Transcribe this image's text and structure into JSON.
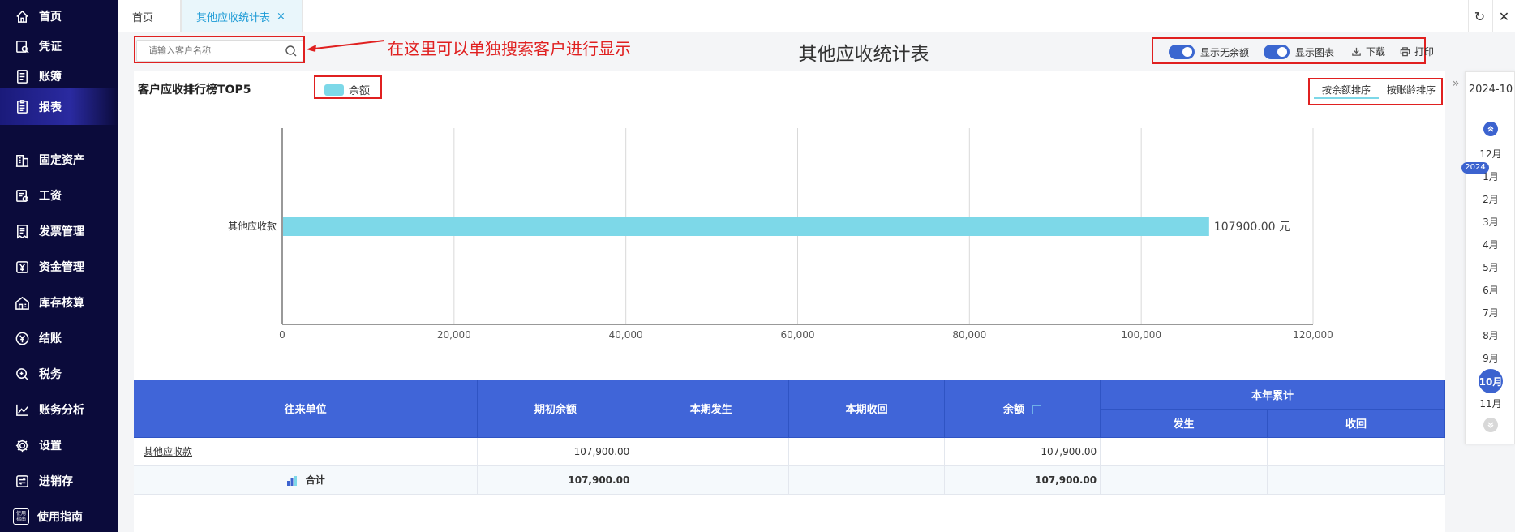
{
  "sidebar": {
    "items": [
      {
        "label": "首页",
        "icon": "home-icon"
      },
      {
        "label": "凭证",
        "icon": "voucher-icon"
      },
      {
        "label": "账簿",
        "icon": "ledger-icon"
      },
      {
        "label": "报表",
        "icon": "report-icon",
        "active": true
      },
      {
        "label": "固定资产",
        "icon": "building-icon"
      },
      {
        "label": "工资",
        "icon": "salary-icon"
      },
      {
        "label": "发票管理",
        "icon": "invoice-icon"
      },
      {
        "label": "资金管理",
        "icon": "yen-icon"
      },
      {
        "label": "库存核算",
        "icon": "warehouse-icon"
      },
      {
        "label": "结账",
        "icon": "settle-icon"
      },
      {
        "label": "税务",
        "icon": "tax-icon"
      },
      {
        "label": "账务分析",
        "icon": "analysis-icon"
      },
      {
        "label": "设置",
        "icon": "gear-icon"
      },
      {
        "label": "进销存",
        "icon": "inventory-icon"
      },
      {
        "label": "使用指南",
        "icon": "guide-icon"
      }
    ],
    "guide_icon_text": "使用指南"
  },
  "tabs": {
    "home": "首页",
    "active": "其他应收统计表",
    "close": "×",
    "refresh": "↻",
    "close_window": "✕"
  },
  "toolbar": {
    "search_placeholder": "请输入客户名称",
    "annotation": "在这里可以单独搜索客户进行显示",
    "page_title": "其他应收统计表",
    "toggle_zero_balance": "显示无余额",
    "toggle_chart": "显示图表",
    "download": "下载",
    "print": "打印"
  },
  "chart_section": {
    "title": "客户应收排行榜TOP5",
    "legend": "余额",
    "sort_by_amount": "按余额排序",
    "sort_by_aging": "按账龄排序"
  },
  "chart_data": {
    "type": "bar",
    "orientation": "horizontal",
    "categories": [
      "其他应收款"
    ],
    "series": [
      {
        "name": "余额",
        "values": [
          107900.0
        ]
      }
    ],
    "value_label_suffix": " 元",
    "value_labels": [
      "107900.00 元"
    ],
    "xlim": [
      0,
      120000
    ],
    "xticks": [
      0,
      20000,
      40000,
      60000,
      80000,
      100000,
      120000
    ],
    "xtick_labels": [
      "0",
      "20,000",
      "40,000",
      "60,000",
      "80,000",
      "100,000",
      "120,000"
    ],
    "grid": true,
    "legend_position": "top-left",
    "bar_color": "#7dd8e8"
  },
  "table": {
    "headers": {
      "unit": "往来单位",
      "opening": "期初余额",
      "period_occur": "本期发生",
      "period_recover": "本期收回",
      "balance": "余额",
      "ytd": "本年累计",
      "ytd_occur": "发生",
      "ytd_recover": "收回"
    },
    "rows": [
      {
        "unit": "其他应收款",
        "opening": "107,900.00",
        "period_occur": "",
        "period_recover": "",
        "balance": "107,900.00",
        "ytd_occur": "",
        "ytd_recover": ""
      }
    ],
    "total": {
      "label": "合计",
      "opening": "107,900.00",
      "period_occur": "",
      "period_recover": "",
      "balance": "107,900.00",
      "ytd_occur": "",
      "ytd_recover": ""
    }
  },
  "date_picker": {
    "current": "2024-10",
    "year_badge": "2024",
    "months": [
      "12月",
      "1月",
      "2月",
      "3月",
      "4月",
      "5月",
      "6月",
      "7月",
      "8月",
      "9月",
      "10月",
      "11月"
    ],
    "active_month": "10月"
  },
  "colors": {
    "sidebar_bg": "#0b0b3b",
    "accent": "#3c63cf",
    "table_header": "#4065d8",
    "bar": "#7dd8e8",
    "annotation_red": "#e02020",
    "tab_active_text": "#1d9bd6"
  }
}
